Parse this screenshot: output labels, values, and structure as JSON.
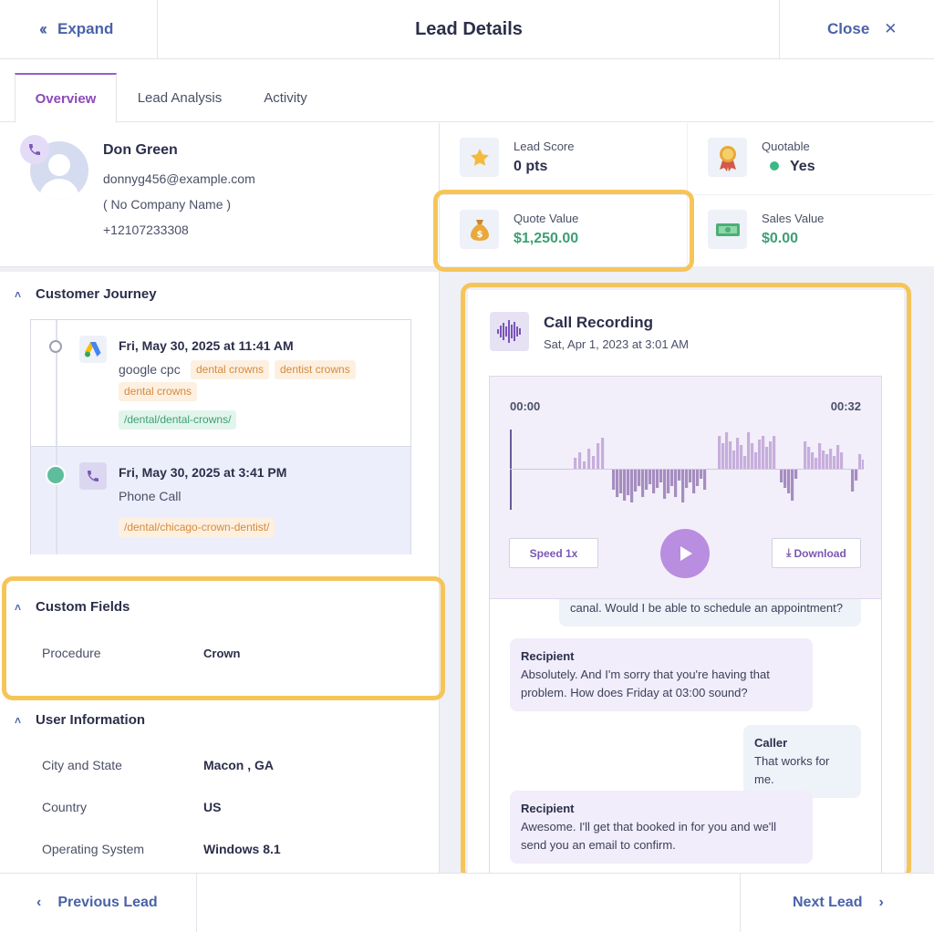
{
  "header": {
    "expand_label": "Expand",
    "title": "Lead Details",
    "close_label": "Close"
  },
  "tabs": [
    {
      "label": "Overview",
      "active": true
    },
    {
      "label": "Lead Analysis",
      "active": false
    },
    {
      "label": "Activity",
      "active": false
    }
  ],
  "profile": {
    "name": "Don Green",
    "email": "donnyg456@example.com",
    "company": "( No Company Name )",
    "phone": "+12107233308"
  },
  "stats": {
    "lead_score": {
      "label": "Lead Score",
      "value": "0 pts",
      "icon": "star-icon"
    },
    "quotable": {
      "label": "Quotable",
      "value": "Yes",
      "icon": "award-icon"
    },
    "quote_value": {
      "label": "Quote Value",
      "value": "$1,250.00",
      "icon": "money-bag-icon"
    },
    "sales_value": {
      "label": "Sales Value",
      "value": "$0.00",
      "icon": "cash-icon"
    }
  },
  "customer_journey": {
    "title": "Customer Journey",
    "events": [
      {
        "date": "Fri, May 30, 2025 at 11:41 AM",
        "source": "google cpc",
        "tags": [
          "dental crowns",
          "dentist crowns",
          "dental crowns"
        ],
        "path": "/dental/dental-crowns/",
        "icon": "google-ads-icon"
      },
      {
        "date": "Fri, May 30, 2025 at 3:41 PM",
        "source": "Phone Call",
        "path": "/dental/chicago-crown-dentist/",
        "icon": "phone-icon"
      }
    ]
  },
  "custom_fields": {
    "title": "Custom Fields",
    "rows": [
      {
        "label": "Procedure",
        "value": "Crown"
      }
    ]
  },
  "user_information": {
    "title": "User Information",
    "rows": [
      {
        "label": "City and State",
        "value": "Macon , GA"
      },
      {
        "label": "Country",
        "value": "US"
      },
      {
        "label": "Operating System",
        "value": "Windows 8.1"
      }
    ]
  },
  "call_recording": {
    "title": "Call Recording",
    "date": "Sat, Apr 1, 2023 at 3:01 AM",
    "time_current": "00:00",
    "time_total": "00:32",
    "speed_label": "Speed 1x",
    "download_label": "Download",
    "transcript": [
      {
        "speaker": "",
        "text": "canal. Would I be able to schedule an appointment?"
      },
      {
        "speaker": "Recipient",
        "text": "Absolutely. And I'm sorry that you're having that problem. How does Friday at 03:00 sound?"
      },
      {
        "speaker": "Caller",
        "text": "That works for me."
      },
      {
        "speaker": "Recipient",
        "text": "Awesome. I'll get that booked in for you and we'll send you an email to confirm."
      }
    ]
  },
  "footer": {
    "prev_label": "Previous Lead",
    "next_label": "Next Lead"
  },
  "colors": {
    "accent_blue": "#4a62a8",
    "accent_purple": "#8c4ab8",
    "value_green": "#3c9f74",
    "highlight": "#f6c55a"
  }
}
